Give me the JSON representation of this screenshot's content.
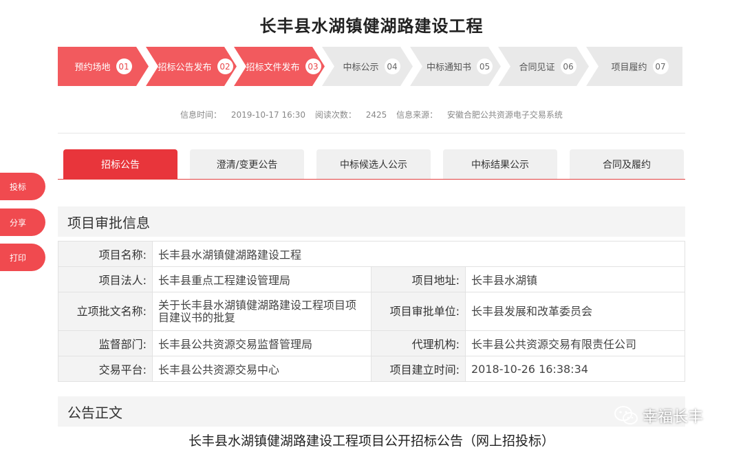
{
  "page_title": "长丰县水湖镇健湖路建设工程",
  "steps": [
    {
      "label": "预约场地",
      "num": "01",
      "active": true
    },
    {
      "label": "招标公告发布",
      "num": "02",
      "active": true
    },
    {
      "label": "招标文件发布",
      "num": "03",
      "active": true
    },
    {
      "label": "中标公示",
      "num": "04",
      "active": false
    },
    {
      "label": "中标通知书",
      "num": "05",
      "active": false
    },
    {
      "label": "合同见证",
      "num": "06",
      "active": false
    },
    {
      "label": "项目履约",
      "num": "07",
      "active": false
    }
  ],
  "colors": {
    "accent": "#e8474a",
    "step_inactive": "#e9e9e9",
    "tab_active": "#e8353b"
  },
  "meta": {
    "time_label": "信息时间：",
    "time_value": "2019-10-17 16:30",
    "reads_label": "阅读次数：",
    "reads_value": "2425",
    "source_label": "信息来源：",
    "source_value": "安徽合肥公共资源电子交易系统"
  },
  "tabs": [
    "招标公告",
    "澄清/变更公告",
    "中标候选人公示",
    "中标结果公示",
    "合同及履约"
  ],
  "side_buttons": [
    "投标",
    "分享",
    "打印"
  ],
  "approval": {
    "heading": "项目审批信息",
    "project_name_label": "项目名称:",
    "project_name": "长丰县水湖镇健湖路建设工程",
    "legal_label": "项目法人:",
    "legal": "长丰县重点工程建设管理局",
    "address_label": "项目地址:",
    "address": "长丰县水湖镇",
    "approval_doc_label": "立项批文名称:",
    "approval_doc": "关于长丰县水湖镇健湖路建设工程项目项目建议书的批复",
    "approval_unit_label": "项目审批单位:",
    "approval_unit": "长丰县发展和改革委员会",
    "supervisor_label": "监督部门:",
    "supervisor": "长丰县公共资源交易监督管理局",
    "agency_label": "代理机构:",
    "agency": "长丰县公共资源交易有限责任公司",
    "platform_label": "交易平台:",
    "platform": "长丰县公共资源交易中心",
    "created_label": "项目建立时间:",
    "created": "2018-10-26 16:38:34"
  },
  "notice": {
    "heading": "公告正文",
    "title": "长丰县水湖镇健湖路建设工程项目公开招标公告（网上招投标）"
  },
  "watermark": {
    "text": "幸福长丰",
    "icon": "wechat-icon"
  }
}
